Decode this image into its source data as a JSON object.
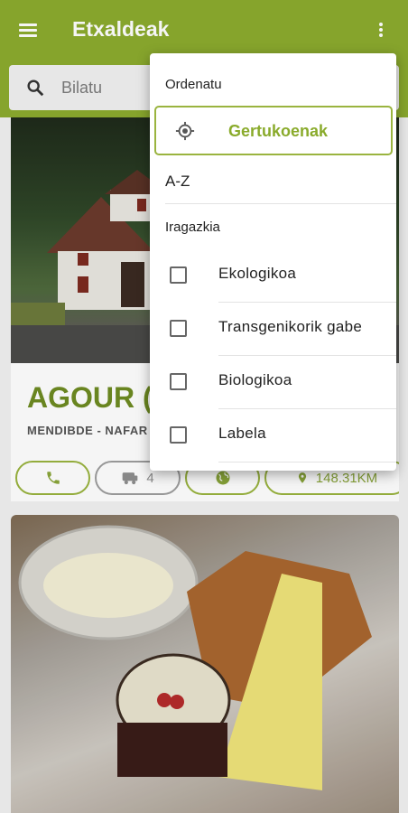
{
  "app": {
    "title": "Etxaldeak"
  },
  "search": {
    "placeholder": "Bilatu"
  },
  "card1": {
    "title": "AGOUR (",
    "subtitle": "MENDIBDE - NAFAR",
    "actions": {
      "count": "4",
      "distance": "148.31KM"
    }
  },
  "popup": {
    "sort_header": "Ordenatu",
    "sort_options": [
      "Gertukoenak",
      "A-Z"
    ],
    "filter_header": "Iragazkia",
    "filters": [
      {
        "label": "Ekologikoa",
        "checked": false
      },
      {
        "label": "Transgenikorik gabe",
        "checked": false
      },
      {
        "label": "Biologikoa",
        "checked": false
      },
      {
        "label": "Labela",
        "checked": false
      }
    ]
  },
  "colors": {
    "accent": "#8cab2e",
    "accent_text": "#8aab2c",
    "title_green": "#6e8b22"
  },
  "icons": [
    "menu-icon",
    "more-vert-icon",
    "search-icon",
    "my-location-icon",
    "phone-icon",
    "van-icon",
    "globe-icon",
    "location-pin-icon"
  ]
}
